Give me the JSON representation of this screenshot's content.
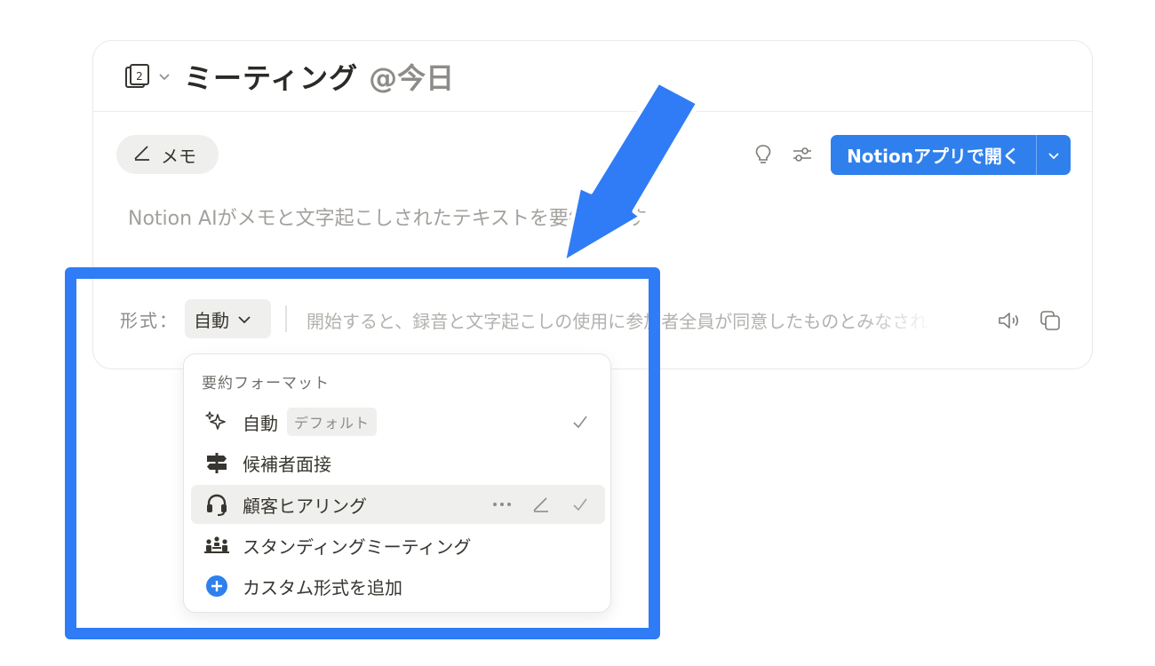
{
  "header": {
    "title": "ミーティング",
    "date": "@今日"
  },
  "toolbar": {
    "memo_label": "メモ",
    "open_button_label": "Notionアプリで開く"
  },
  "summary": {
    "placeholder": "Notion AIがメモと文字起こしされたテキストを要約します"
  },
  "format_bar": {
    "label": "形式：",
    "selected": "自動",
    "consent_text": "開始すると、録音と文字起こしの使用に参加者全員が同意したものとみなされます"
  },
  "menu": {
    "title": "要約フォーマット",
    "items": [
      {
        "label": "自動",
        "badge": "デフォルト",
        "icon": "sparkle-icon",
        "checked": true
      },
      {
        "label": "候補者面接",
        "icon": "signpost-icon"
      },
      {
        "label": "顧客ヒアリング",
        "icon": "headset-icon",
        "hovered": true
      },
      {
        "label": "スタンディングミーティング",
        "icon": "people-icon"
      },
      {
        "label": "カスタム形式を追加",
        "icon": "plus-circle-icon"
      }
    ]
  },
  "colors": {
    "accent": "#2f80ed",
    "annotation": "#2f7cf6",
    "pill_bg": "#efefed",
    "muted_text": "#a3a19d"
  }
}
